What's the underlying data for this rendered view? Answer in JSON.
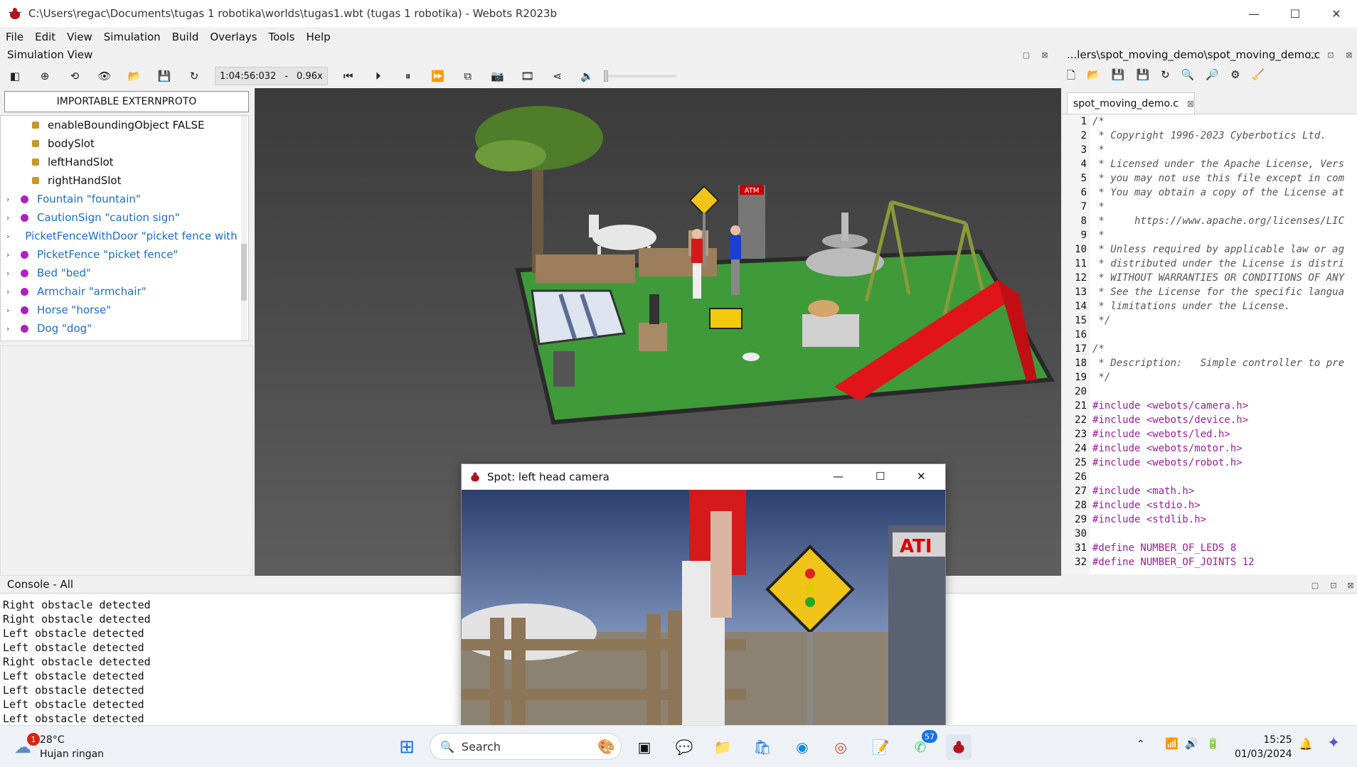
{
  "window": {
    "title": "C:\\Users\\regac\\Documents\\tugas 1 robotika\\worlds\\tugas1.wbt (tugas 1 robotika) - Webots R2023b",
    "minimize": "—",
    "maximize": "☐",
    "close": "✕"
  },
  "menu": [
    "File",
    "Edit",
    "View",
    "Simulation",
    "Build",
    "Overlays",
    "Tools",
    "Help"
  ],
  "simulation_view": {
    "title": "Simulation View",
    "time": "1:04:56:032",
    "separator": "-",
    "speed": "0.96x"
  },
  "scene_tree": {
    "extern_button": "IMPORTABLE EXTERNPROTO",
    "fields": [
      "enableBoundingObject FALSE",
      "bodySlot",
      "leftHandSlot",
      "rightHandSlot"
    ],
    "nodes": [
      "Fountain \"fountain\"",
      "CautionSign \"caution sign\"",
      "PicketFenceWithDoor \"picket fence with door\"",
      "PicketFence \"picket fence\"",
      "Bed \"bed\"",
      "Armchair \"armchair\"",
      "Horse \"horse\"",
      "Dog \"dog\""
    ]
  },
  "viewport": {
    "atm_label": "ATM"
  },
  "editor": {
    "path": "...lers\\spot_moving_demo\\spot_moving_demo.c",
    "tab": "spot_moving_demo.c",
    "lines": [
      "/*",
      " * Copyright 1996-2023 Cyberbotics Ltd.",
      " *",
      " * Licensed under the Apache License, Vers",
      " * you may not use this file except in com",
      " * You may obtain a copy of the License at",
      " *",
      " *     https://www.apache.org/licenses/LIC",
      " *",
      " * Unless required by applicable law or ag",
      " * distributed under the License is distri",
      " * WITHOUT WARRANTIES OR CONDITIONS OF ANY",
      " * See the License for the specific langua",
      " * limitations under the License.",
      " */",
      "",
      "/*",
      " * Description:   Simple controller to pre",
      " */",
      "",
      "#include <webots/camera.h>",
      "#include <webots/device.h>",
      "#include <webots/led.h>",
      "#include <webots/motor.h>",
      "#include <webots/robot.h>",
      "",
      "#include <math.h>",
      "#include <stdio.h>",
      "#include <stdlib.h>",
      "",
      "#define NUMBER_OF_LEDS 8",
      "#define NUMBER_OF_JOINTS 12"
    ]
  },
  "console": {
    "title": "Console - All",
    "lines": [
      "Right obstacle detected",
      "Right obstacle detected",
      "Left obstacle detected",
      "Left obstacle detected",
      "Right obstacle detected",
      "Left obstacle detected",
      "Left obstacle detected",
      "Left obstacle detected",
      "Left obstacle detected"
    ]
  },
  "camera_window": {
    "title": "Spot: left head camera",
    "minimize": "—",
    "maximize": "☐",
    "close": "✕",
    "atm_text": "ATI"
  },
  "taskbar": {
    "weather_temp": "28°C",
    "weather_desc": "Hujan ringan",
    "weather_badge": "1",
    "search": "Search",
    "whatsapp_badge": "57",
    "time": "15:25",
    "date": "01/03/2024"
  },
  "colors": {
    "accent": "#1a6ec8",
    "node_dot": "#b020c0",
    "field_dot": "#c49a2a",
    "preproc": "#9b1d9b",
    "grass": "#3f9a3a",
    "slide": "#e0141a"
  }
}
